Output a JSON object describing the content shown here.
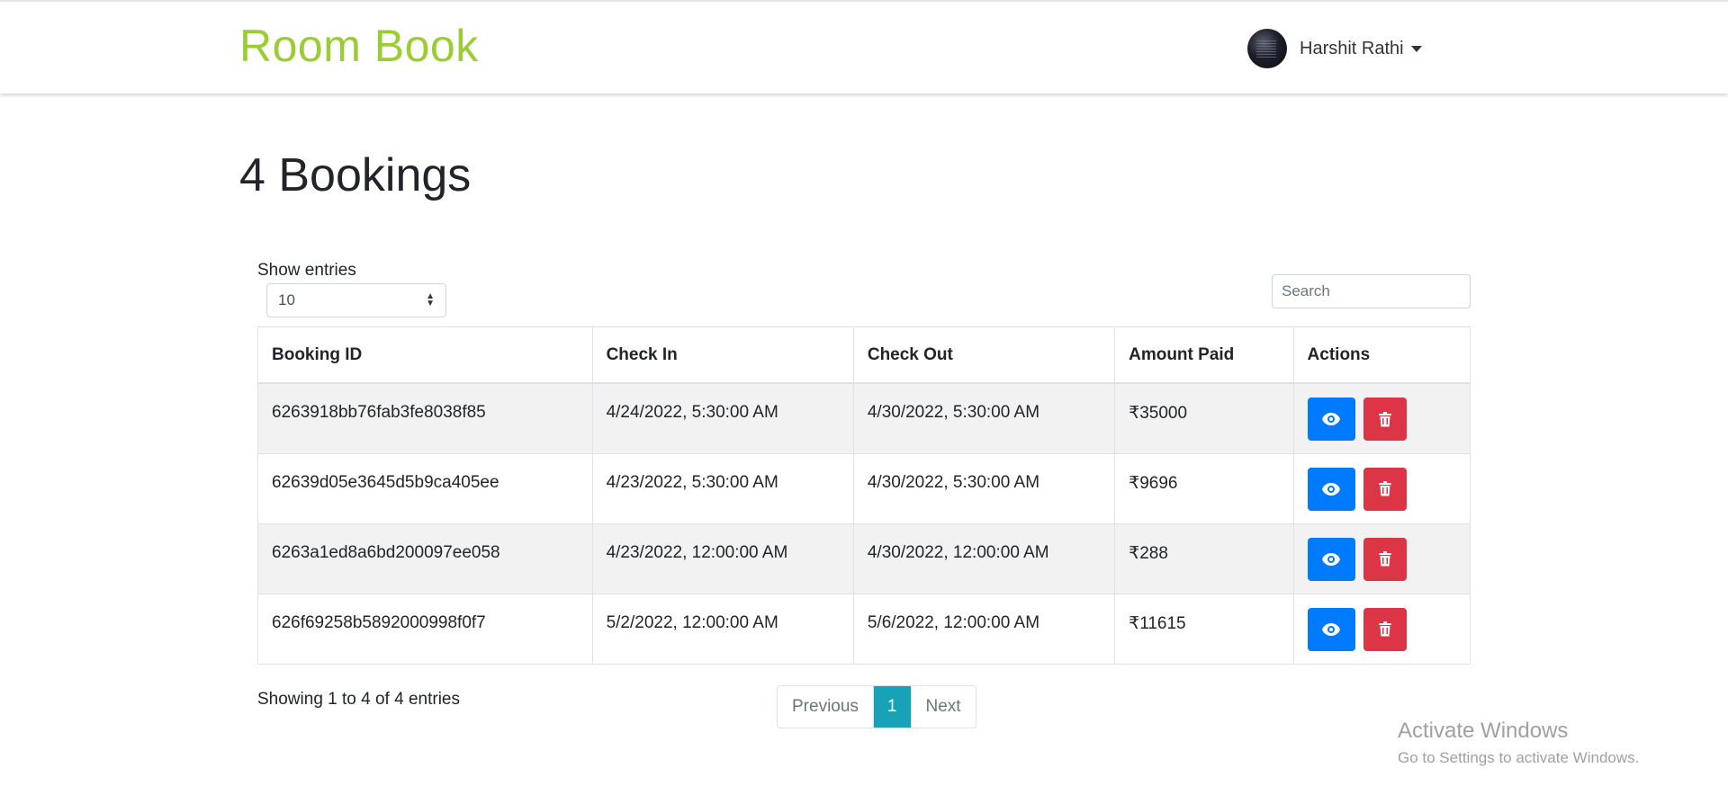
{
  "brand": "Room Book",
  "user": {
    "name": "Harshit Rathi"
  },
  "page": {
    "title": "4 Bookings"
  },
  "table_controls": {
    "length_label": "Show entries",
    "length_value": "10",
    "search_placeholder": "Search"
  },
  "table": {
    "headers": [
      "Booking ID",
      "Check In",
      "Check Out",
      "Amount Paid",
      "Actions"
    ],
    "rows": [
      {
        "id": "6263918bb76fab3fe8038f85",
        "check_in": "4/24/2022, 5:30:00 AM",
        "check_out": "4/30/2022, 5:30:00 AM",
        "amount": "₹35000"
      },
      {
        "id": "62639d05e3645d5b9ca405ee",
        "check_in": "4/23/2022, 5:30:00 AM",
        "check_out": "4/30/2022, 5:30:00 AM",
        "amount": "₹9696"
      },
      {
        "id": "6263a1ed8a6bd200097ee058",
        "check_in": "4/23/2022, 12:00:00 AM",
        "check_out": "4/30/2022, 12:00:00 AM",
        "amount": "₹288"
      },
      {
        "id": "626f69258b5892000998f0f7",
        "check_in": "5/2/2022, 12:00:00 AM",
        "check_out": "5/6/2022, 12:00:00 AM",
        "amount": "₹11615"
      }
    ]
  },
  "footer": {
    "info": "Showing 1 to 4 of 4 entries",
    "prev_label": "Previous",
    "page_label": "1",
    "next_label": "Next"
  },
  "watermark": {
    "line1": "Activate Windows",
    "line2": "Go to Settings to activate Windows."
  },
  "colors": {
    "brand": "#9acd32",
    "view_button": "#007bff",
    "delete_button": "#dc3545",
    "active_page": "#17a2b8"
  },
  "icons": {
    "view": "eye-icon",
    "delete": "trash-icon",
    "user_menu": "caret-down-icon"
  }
}
